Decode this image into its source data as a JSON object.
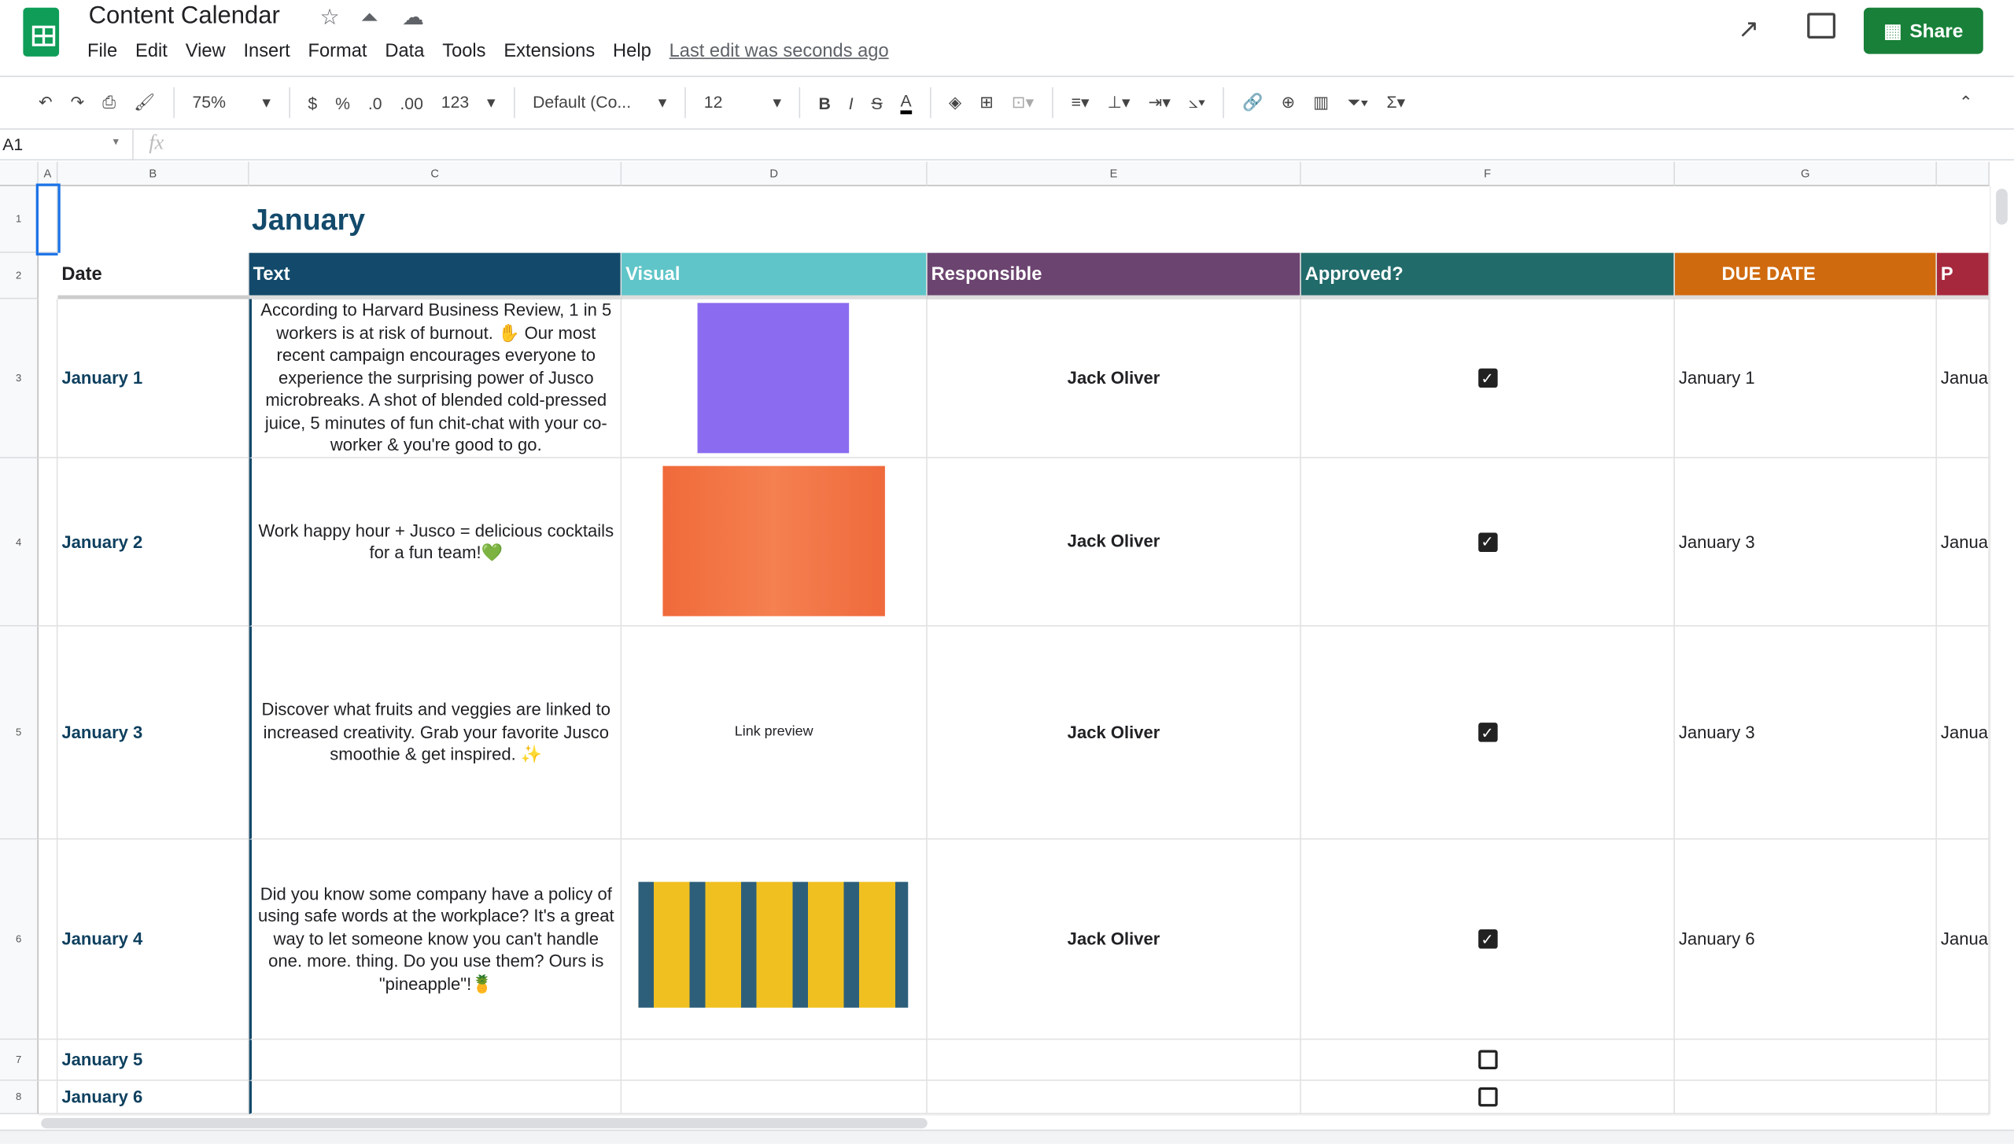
{
  "app": {
    "title": "Content Calendar",
    "menu": [
      "File",
      "Edit",
      "View",
      "Insert",
      "Format",
      "Data",
      "Tools",
      "Extensions",
      "Help"
    ],
    "last_edit": "Last edit was seconds ago",
    "share_label": "Share",
    "brand_color": "#188038"
  },
  "toolbar": {
    "zoom": "75%",
    "dollar": "$",
    "percent": "%",
    "dec_less": ".0",
    "dec_more": ".00",
    "format": "123",
    "font": "Default (Co...",
    "font_size": "12",
    "bold": "B",
    "italic": "I",
    "strike": "S",
    "text_color": "A"
  },
  "formula_bar": {
    "cell_ref": "A1",
    "fx": "fx",
    "value": ""
  },
  "columns": [
    "A",
    "B",
    "C",
    "D",
    "E",
    "F",
    "G"
  ],
  "rows": [
    "1",
    "2",
    "3",
    "4",
    "5",
    "6",
    "7",
    "8"
  ],
  "sheet": {
    "month": "January",
    "headers": [
      {
        "label": "Date",
        "color": "#ffffff"
      },
      {
        "label": "Text",
        "color": "#134a6b"
      },
      {
        "label": "Visual",
        "color": "#5fc5c8"
      },
      {
        "label": "Responsible",
        "color": "#6c4470"
      },
      {
        "label": "Approved?",
        "color": "#226b6b"
      },
      {
        "label": "DUE DATE",
        "color": "#d06a0e"
      },
      {
        "label": "P",
        "color": "#a6283d"
      }
    ],
    "entries": [
      {
        "date": "January 1",
        "text": "According to Harvard Business Review, 1 in 5 workers is at risk of burnout. ✋ Our most recent campaign encourages everyone to experience the surprising power of Jusco microbreaks. A shot of blended cold-pressed juice, 5 minutes of fun chit-chat with your co-worker & you're good to go.",
        "visual": "image",
        "responsible": "Jack Oliver",
        "approved": true,
        "due": "January 1",
        "next": "Januar"
      },
      {
        "date": "January 2",
        "text": "Work happy hour + Jusco = delicious cocktails for a fun team!💚",
        "visual": "image",
        "responsible": "Jack Oliver",
        "approved": true,
        "due": "January 3",
        "next": "Januar"
      },
      {
        "date": "January 3",
        "text": "Discover what fruits and veggies are linked to increased creativity. Grab your favorite Jusco smoothie & get inspired. ✨",
        "visual": "Link preview",
        "responsible": "Jack Oliver",
        "approved": true,
        "due": "January 3",
        "next": "Januar"
      },
      {
        "date": "January 4",
        "text": "Did you know some company have a policy of using safe words at the workplace? It's a great way to let someone know you can't handle one. more. thing. Do you use them? Ours is \"pineapple\"!🍍",
        "visual": "image",
        "responsible": "Jack Oliver",
        "approved": true,
        "due": "January 6",
        "next": "Januar"
      },
      {
        "date": "January 5",
        "text": "",
        "visual": "",
        "responsible": "",
        "approved": false,
        "due": "",
        "next": ""
      },
      {
        "date": "January 6",
        "text": "",
        "visual": "",
        "responsible": "",
        "approved": false,
        "due": "",
        "next": ""
      }
    ]
  }
}
